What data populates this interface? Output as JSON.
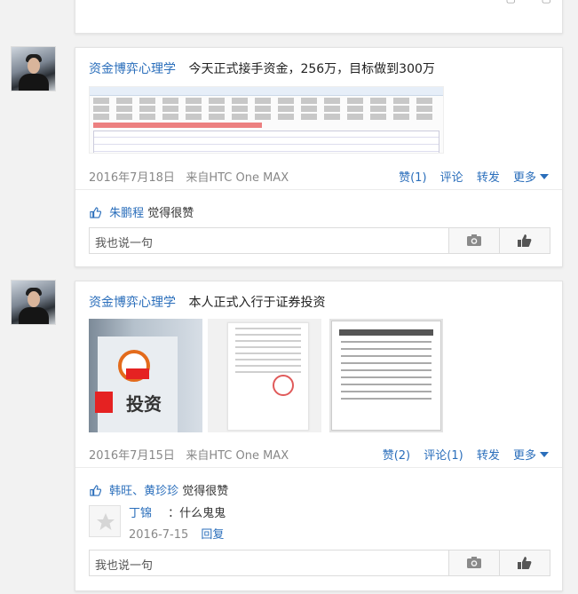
{
  "posts": [
    {
      "author": "资金博弈心理学",
      "content": "今天正式接手资金，256万，目标做到300万",
      "date": "2016年7月18日",
      "source": "来自HTC One MAX",
      "actions": {
        "like": "赞(1)",
        "comment": "评论",
        "forward": "转发",
        "more": "更多"
      },
      "likes": {
        "users": "朱鹏程",
        "suffix": "觉得很赞"
      },
      "reply_placeholder": "我也说一句"
    },
    {
      "author": "资金博弈心理学",
      "content": "本人正式入行于证券投资",
      "date": "2016年7月15日",
      "source": "来自HTC One MAX",
      "actions": {
        "like": "赞(2)",
        "comment": "评论(1)",
        "forward": "转发",
        "more": "更多"
      },
      "likes": {
        "users": "韩旺、黄珍珍",
        "suffix": "觉得很赞"
      },
      "comment": {
        "name": "丁锦",
        "text": "：什么鬼鬼",
        "date": "2016-7-15",
        "reply": "回复"
      },
      "reply_placeholder": "我也说一句"
    }
  ],
  "colors": {
    "link": "#2a6ebb",
    "meta": "#888888",
    "background": "#f2f2f2"
  },
  "icons": [
    "camera-icon",
    "thumbs-up-icon",
    "chevron-down-icon",
    "default-avatar-icon"
  ]
}
